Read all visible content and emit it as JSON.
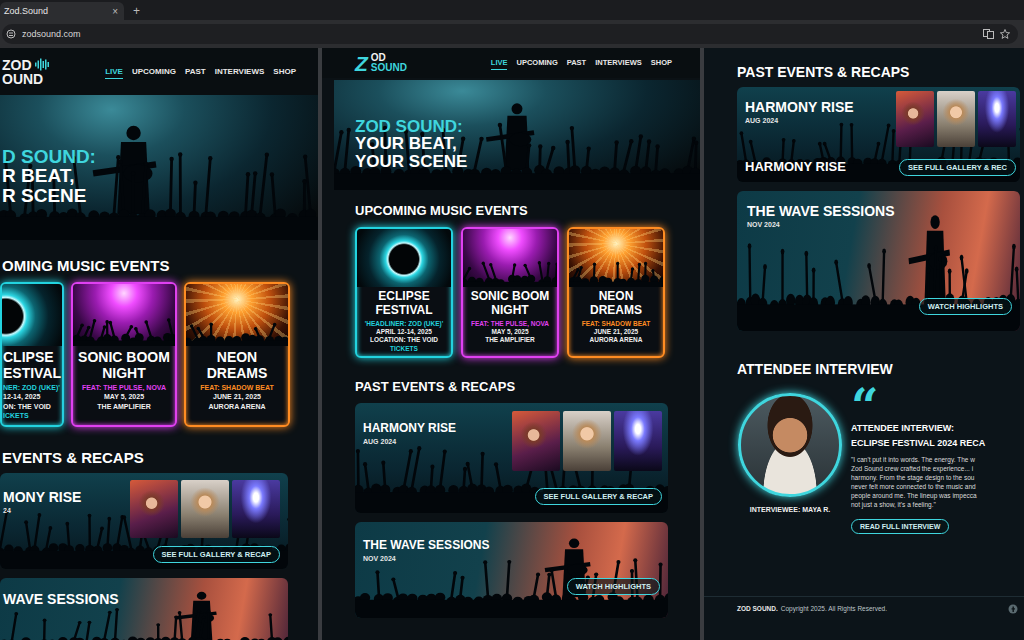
{
  "browser": {
    "tab_title": "Zod.Sound",
    "tab_close": "×",
    "new_tab": "+",
    "url": "zodsound.com"
  },
  "left_view": {
    "logo": [
      "ZOD",
      "OUND"
    ],
    "nav": [
      {
        "label": "LIVE",
        "selected": true
      },
      {
        "label": "UPCOMING",
        "selected": false
      },
      {
        "label": "PAST",
        "selected": false
      },
      {
        "label": "INTERVIEWS",
        "selected": false
      },
      {
        "label": "SHOP",
        "selected": false
      }
    ],
    "hero": [
      "D SOUND:",
      "R BEAT,",
      "R SCENE"
    ],
    "upcoming_title": "OMING MUSIC EVENTS",
    "events": [
      {
        "kind": "cropped",
        "color": "#22d3df",
        "title": [
          "CLIPSE",
          "ESTIVAL"
        ],
        "feat": "NER: ZOD (UKE)'",
        "date": "12-14, 2025",
        "place": "ON: THE VOID",
        "action": "ICKETS"
      },
      {
        "kind": "full",
        "color": "#e040f2",
        "title": [
          "SONIC BOOM",
          "NIGHT"
        ],
        "feat": "FEAT: THE PULSE, NOVA",
        "date": "MAY 5, 2025",
        "place": "THE AMPLIFIER"
      },
      {
        "kind": "full",
        "color": "#ff8c22",
        "title": [
          "NEON",
          "DREAMS"
        ],
        "feat": "FEAT: SHADOW BEAT",
        "date": "JUNE 21, 2025",
        "place": "AURORA ARENA"
      }
    ],
    "past_title": "EVENTS & RECAPS",
    "recaps": [
      {
        "kind": "gallery",
        "title": "MONY RISE",
        "date": "24",
        "button": "SEE FULL GALLERY & RECAP"
      },
      {
        "kind": "video",
        "title": "WAVE SESSIONS"
      }
    ]
  },
  "middle_view": {
    "logo_mark": "Z",
    "logo": [
      "OD",
      "SOUND"
    ],
    "nav": [
      {
        "label": "LIVE",
        "selected": true
      },
      {
        "label": "UPCOMING",
        "selected": false
      },
      {
        "label": "PAST",
        "selected": false
      },
      {
        "label": "INTERVIEWS",
        "selected": false
      },
      {
        "label": "SHOP",
        "selected": false
      }
    ],
    "hero": [
      "ZOD SOUND:",
      "YOUR BEAT,",
      "YOUR SCENE"
    ],
    "upcoming_title": "UPCOMING MUSIC EVENTS",
    "events": [
      {
        "kind": "full",
        "color": "#22d3df",
        "title": [
          "ECLIPSE",
          "FESTIVAL"
        ],
        "feat": "'HEADLINER: ZOD (UKE)'",
        "date": "APRIL 12-14, 2025",
        "place": "LOCATION: THE VOID",
        "action": "TICKETS"
      },
      {
        "kind": "full",
        "color": "#e040f2",
        "title": [
          "SONIC BOOM",
          "NIGHT"
        ],
        "feat": "FEAT: THE PULSE, NOVA",
        "date": "MAY 5, 2025",
        "place": "THE AMPLIFIER"
      },
      {
        "kind": "full",
        "color": "#ff8c22",
        "title": [
          "NEON",
          "DREAMS"
        ],
        "feat": "FEAT: SHADOW BEAT",
        "date": "JUNE 21, 2025",
        "place": "AURORA ARENA"
      }
    ],
    "past_title": "PAST EVENTS & RECAPS",
    "recaps": [
      {
        "kind": "gallery",
        "title": "HARMONY RISE",
        "date": "AUG 2024",
        "button": "SEE FULL GALLERY & RECAP"
      },
      {
        "kind": "video",
        "title": "THE WAVE SESSIONS",
        "date": "NOV 2024",
        "button": "WATCH HIGHLIGHTS"
      }
    ]
  },
  "right_view": {
    "past_title": "PAST EVENTS & RECAPS",
    "recaps": [
      {
        "kind": "gallery",
        "title": "HARMONY RISE",
        "date": "AUG 2024",
        "subtitle": "HARMONY RISE",
        "button": "SEE FULL GALLERY & REC"
      },
      {
        "kind": "video",
        "title": "THE WAVE SESSIONS",
        "date": "NOV 2024",
        "button": "WATCH HIGHLIGHTS"
      }
    ],
    "interview": {
      "title": "ATTENDEE INTERVIEW",
      "quote_mark": "“",
      "heading": [
        "ATTENDEE INTERVIEW:",
        "ECLIPSE FESTIVAL 2024 RECA"
      ],
      "quote_lines": [
        "\"I can't put it into words. The energy. The w",
        "Zod Sound crew crafted the experience... i",
        "harmony. From the stage design to the sou",
        "never felt more connected to the music and",
        "people around me. The lineup was impecca",
        "not just a show, it's a feeling.\""
      ],
      "interviewee": "INTERVIEWEE: MAYA R.",
      "button": "READ FULL INTERVIEW"
    },
    "footer_brand": "ZOD SOUND.",
    "footer_text": "Copyright 2025. All Rights Reserved."
  }
}
